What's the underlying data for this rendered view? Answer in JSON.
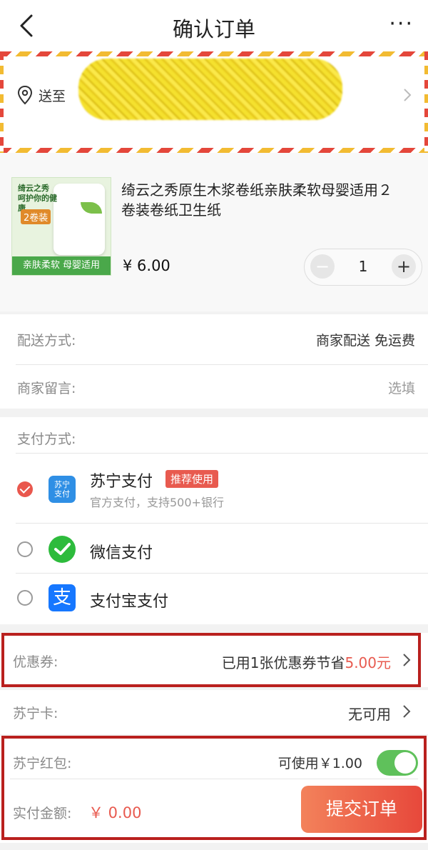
{
  "header": {
    "title": "确认订单",
    "more": "···"
  },
  "address": {
    "send_to": "送至"
  },
  "product": {
    "name": "绮云之秀原生木浆卷纸亲肤柔软母婴适用２卷装卷纸卫生纸",
    "price": "¥ 6.00",
    "quantity": "1",
    "thumb": {
      "brand": "绮云之秀 呵护你的健康",
      "badge": "2卷装",
      "banner": "亲肤柔软 母婴适用"
    }
  },
  "delivery": {
    "label": "配送方式:",
    "value": "商家配送 免运费"
  },
  "message": {
    "label": "商家留言:",
    "placeholder": "选填"
  },
  "payment": {
    "label": "支付方式:",
    "methods": [
      {
        "name": "苏宁支付",
        "icon": "suning-pay-icon",
        "icon_text": "苏宁\n支付",
        "badge": "推荐使用",
        "desc": "官方支付，支持500+银行",
        "selected": true
      },
      {
        "name": "微信支付",
        "icon": "wechat-pay-icon",
        "selected": false
      },
      {
        "name": "支付宝支付",
        "icon": "alipay-icon",
        "icon_text": "支",
        "selected": false
      }
    ]
  },
  "coupon": {
    "label": "优惠券:",
    "value_prefix": "已用1张优惠券节省",
    "value_amount": "5.00元"
  },
  "suning_card": {
    "label": "苏宁卡:",
    "value": "无可用"
  },
  "red_packet": {
    "label": "苏宁红包:",
    "value": "可使用￥1.00",
    "enabled": true
  },
  "total": {
    "label": "实付金额:",
    "amount": "￥ 0.00"
  },
  "submit": {
    "label": "提交订单"
  },
  "colors": {
    "accent_red": "#e85a4f",
    "toggle_green": "#5fc15b",
    "highlight_box": "#b9201e"
  }
}
